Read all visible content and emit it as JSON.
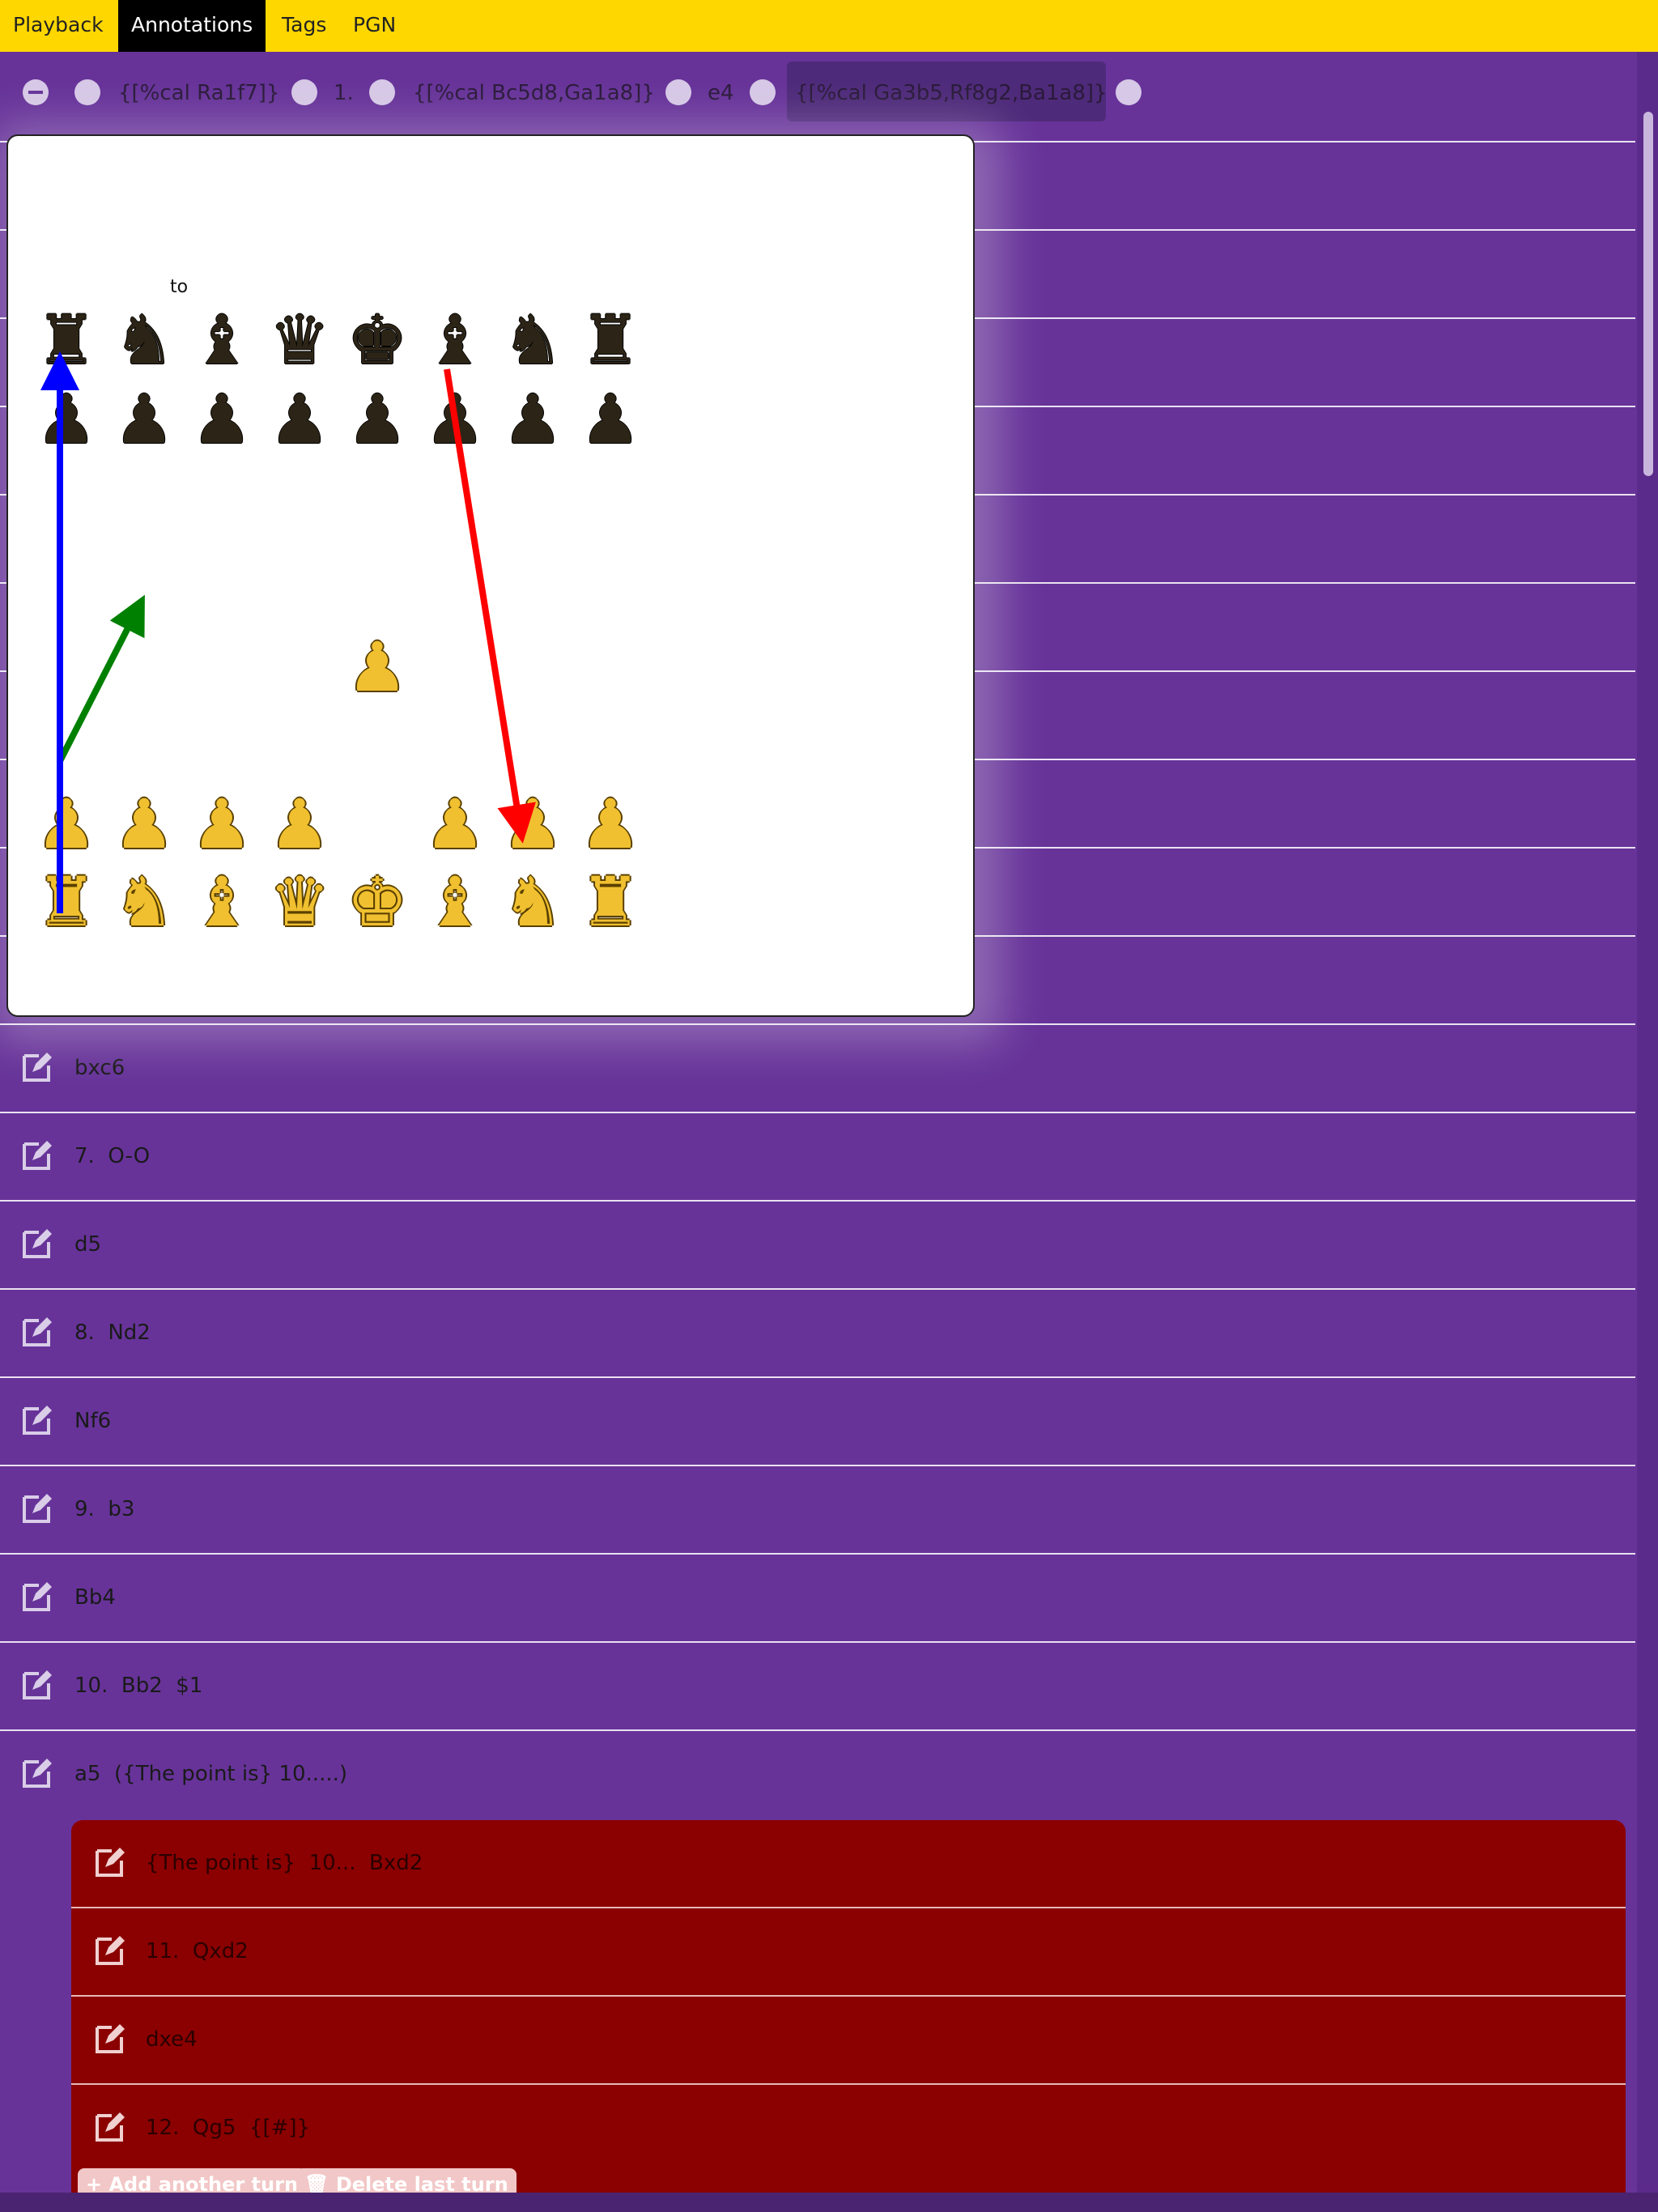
{
  "tabs": [
    {
      "label": "Playback",
      "active": false
    },
    {
      "label": "Annotations",
      "active": true
    },
    {
      "label": "Tags",
      "active": false
    },
    {
      "label": "PGN",
      "active": false
    }
  ],
  "control_row": {
    "items": [
      "{[%cal Ra1f7]}",
      "1.",
      "{[%cal Bc5d8,Ga1a8]}",
      "e4",
      "{[%cal Ga3b5,Rf8g2,Ba1a8]}"
    ]
  },
  "popup": {
    "label": "to",
    "pieces": {
      "black_back": [
        "♜",
        "♞",
        "♝",
        "♛",
        "♚",
        "♝",
        "♞",
        "♜"
      ],
      "black_pawns": [
        "♟",
        "♟",
        "♟",
        "♟",
        "♟",
        "♟",
        "♟",
        "♟"
      ],
      "white_pawns": [
        "♟",
        "♟",
        "♟",
        "♟",
        "",
        "♟",
        "♟",
        "♟"
      ],
      "white_e4": "♟",
      "white_back": [
        "♜",
        "♞",
        "♝",
        "♛",
        "♚",
        "♝",
        "♞",
        "♜"
      ]
    },
    "arrow_colors": {
      "blue": "#0000ff",
      "green": "#008000",
      "red": "#ff0000"
    }
  },
  "moves": [
    "bxc6",
    "7.  O-O",
    "d5",
    "8.  Nd2",
    "Nf6",
    "9.  b3",
    "Bb4",
    "10.  Bb2  $1",
    "a5  ({The point is} 10.....)"
  ],
  "variation": {
    "moves": [
      "{The point is}  10...  Bxd2",
      "11.  Qxd2",
      "dxe4",
      "12.  Qg5  {[#]}"
    ],
    "add_label": "+ Add another turn",
    "delete_label": "🗑 Delete last turn"
  },
  "icons": {
    "edit": "edit-icon",
    "minus": "minus-circle-icon",
    "dot": "circle-icon"
  }
}
